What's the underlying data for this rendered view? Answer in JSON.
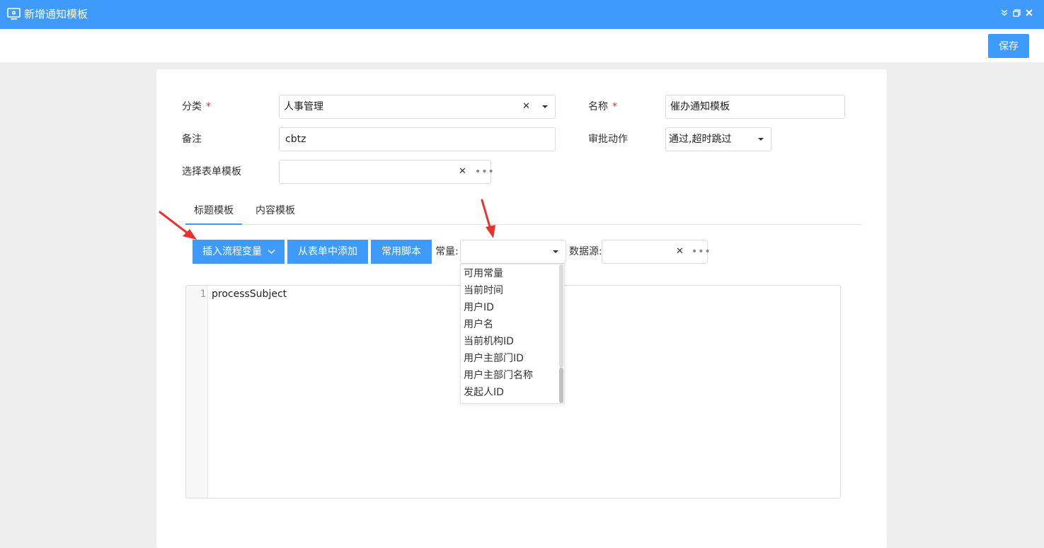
{
  "window": {
    "title": "新增通知模板",
    "icon": "monitor-settings-icon"
  },
  "toolbar": {
    "save_label": "保存"
  },
  "form": {
    "category": {
      "label": "分类",
      "required_mark": "*",
      "value": "人事管理"
    },
    "name": {
      "label": "名称",
      "required_mark": "*",
      "value": "催办通知模板"
    },
    "remark": {
      "label": "备注",
      "value": "cbtz"
    },
    "approval_action": {
      "label": "审批动作",
      "value": "通过,超时跳过"
    },
    "form_template": {
      "label": "选择表单模板",
      "value": ""
    }
  },
  "tabs": [
    {
      "label": "标题模板",
      "active": true
    },
    {
      "label": "内容模板",
      "active": false
    }
  ],
  "actions": {
    "insert_variable": "插入流程变量",
    "add_from_form": "从表单中添加",
    "common_script": "常用脚本",
    "constant_label": "常量:",
    "datasource_label": "数据源:"
  },
  "constant_dropdown": {
    "selected": "",
    "options": [
      "可用常量",
      "当前时间",
      "用户ID",
      "用户名",
      "当前机构ID",
      "用户主部门ID",
      "用户主部门名称",
      "发起人ID"
    ]
  },
  "editor": {
    "line_numbers": [
      "1"
    ],
    "content": "processSubject"
  },
  "colors": {
    "primary": "#3f9bfb",
    "required": "#e3393c",
    "annotation_arrow": "#e8332a"
  }
}
